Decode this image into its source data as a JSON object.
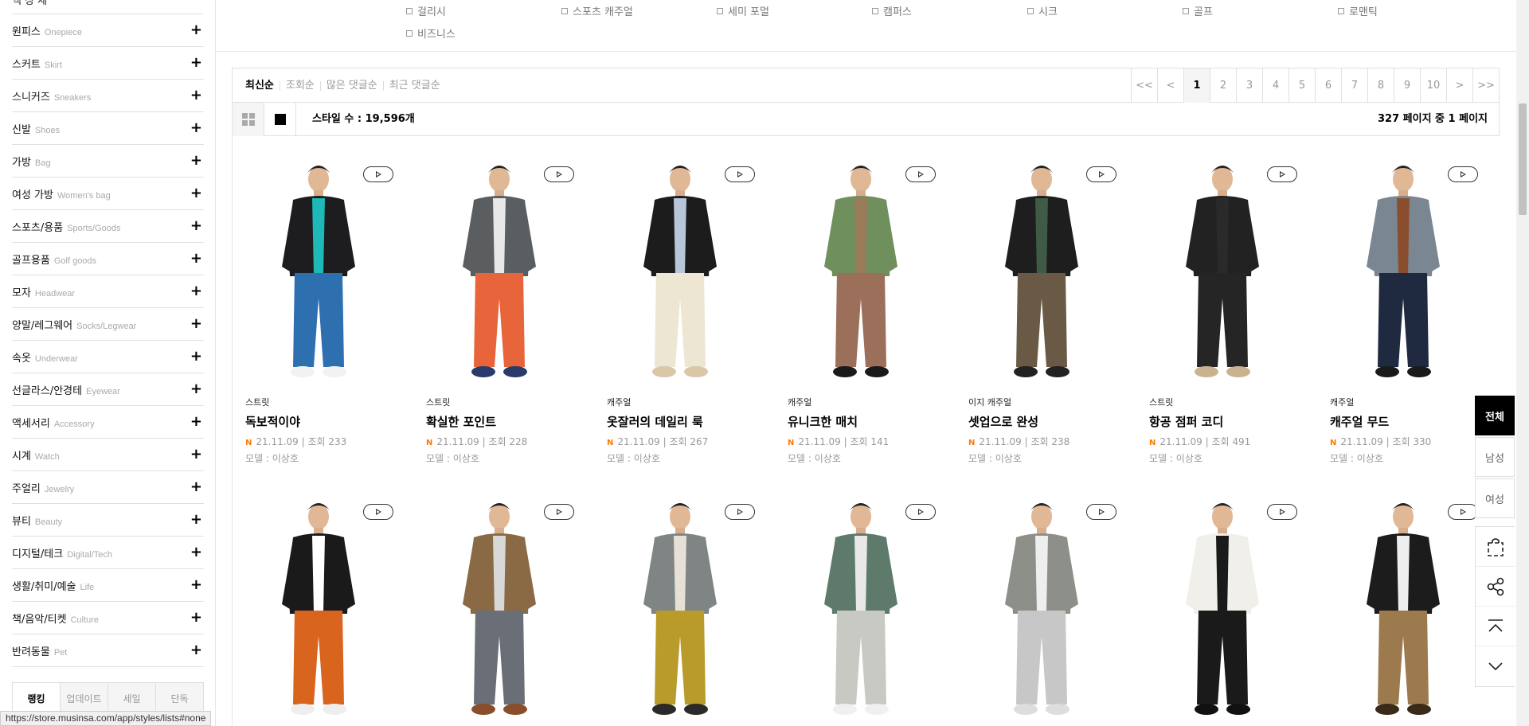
{
  "sidebar": {
    "top_cut": "액 상 세",
    "categories": [
      {
        "ko": "원피스",
        "en": "Onepiece"
      },
      {
        "ko": "스커트",
        "en": "Skirt"
      },
      {
        "ko": "스니커즈",
        "en": "Sneakers"
      },
      {
        "ko": "신발",
        "en": "Shoes"
      },
      {
        "ko": "가방",
        "en": "Bag"
      },
      {
        "ko": "여성 가방",
        "en": "Women's bag"
      },
      {
        "ko": "스포츠/용품",
        "en": "Sports/Goods"
      },
      {
        "ko": "골프용품",
        "en": "Golf goods"
      },
      {
        "ko": "모자",
        "en": "Headwear"
      },
      {
        "ko": "양말/레그웨어",
        "en": "Socks/Legwear"
      },
      {
        "ko": "속옷",
        "en": "Underwear"
      },
      {
        "ko": "선글라스/안경테",
        "en": "Eyewear"
      },
      {
        "ko": "액세서리",
        "en": "Accessory"
      },
      {
        "ko": "시계",
        "en": "Watch"
      },
      {
        "ko": "주얼리",
        "en": "Jewelry"
      },
      {
        "ko": "뷰티",
        "en": "Beauty"
      },
      {
        "ko": "디지털/테크",
        "en": "Digital/Tech"
      },
      {
        "ko": "생활/취미/예술",
        "en": "Life"
      },
      {
        "ko": "책/음악/티켓",
        "en": "Culture"
      },
      {
        "ko": "반려동물",
        "en": "Pet"
      }
    ],
    "plus": "+",
    "rank_tabs": [
      "랭킹",
      "업데이트",
      "세일",
      "단독"
    ]
  },
  "status_url": "https://store.musinsa.com/app/styles/lists#none",
  "style_filter": [
    "걸리시",
    "스포츠 캐주얼",
    "세미 포멀",
    "캠퍼스",
    "시크",
    "골프",
    "로맨틱",
    "비즈니스"
  ],
  "sort": [
    "최신순",
    "조회순",
    "많은 댓글순",
    "최근 댓글순"
  ],
  "pager": [
    "<<",
    "<",
    "1",
    "2",
    "3",
    "4",
    "5",
    "6",
    "7",
    "8",
    "9",
    "10",
    ">",
    ">>"
  ],
  "pager_active": "1",
  "style_count": "스타일 수 : 19,596개",
  "page_count": "327 페이지 중 1 페이지",
  "row1": [
    {
      "cat": "스트릿",
      "title": "독보적이야",
      "date": "21.11.09 | 조회 233",
      "model": "모델 : 이상호",
      "jacket": "#1d1d1f",
      "inner": "#1fb8b8",
      "pants": "#2e6fb0",
      "shoes": "#f2f2f2"
    },
    {
      "cat": "스트릿",
      "title": "확실한 포인트",
      "date": "21.11.09 | 조회 228",
      "model": "모델 : 이상호",
      "jacket": "#5b5e60",
      "inner": "#e8e8e8",
      "pants": "#e8643a",
      "shoes": "#2a3a6a"
    },
    {
      "cat": "캐주얼",
      "title": "옷잘러의 데일리 룩",
      "date": "21.11.09 | 조회 267",
      "model": "모델 : 이상호",
      "jacket": "#1c1c1c",
      "inner": "#b8c6d9",
      "pants": "#ede6d3",
      "shoes": "#d9c7a8"
    },
    {
      "cat": "캐주얼",
      "title": "유니크한 매치",
      "date": "21.11.09 | 조회 141",
      "model": "모델 : 이상호",
      "jacket": "#6f8f5c",
      "inner": "#9a7b5a",
      "pants": "#9b6f5a",
      "shoes": "#1a1a1a"
    },
    {
      "cat": "이지 캐주얼",
      "title": "셋업으로 완성",
      "date": "21.11.09 | 조회 238",
      "model": "모델 : 이상호",
      "jacket": "#1e1e1e",
      "inner": "#3f5a45",
      "pants": "#6a5a45",
      "shoes": "#222222"
    },
    {
      "cat": "스트릿",
      "title": "항공 점퍼 코디",
      "date": "21.11.09 | 조회 491",
      "model": "모델 : 이상호",
      "jacket": "#222222",
      "inner": "#2a2a2a",
      "pants": "#252525",
      "shoes": "#c9b28f"
    },
    {
      "cat": "캐주얼",
      "title": "캐주얼 무드",
      "date": "21.11.09 | 조회 330",
      "model": "모델 : 이상호",
      "jacket": "#7a8792",
      "inner": "#8a4e2e",
      "pants": "#1f2a40",
      "shoes": "#1a1a1a"
    }
  ],
  "row2": [
    {
      "jacket": "#1a1a1a",
      "inner": "#ffffff",
      "pants": "#d8641e",
      "shoes": "#eeeeee"
    },
    {
      "jacket": "#8a6a44",
      "inner": "#d8d8d8",
      "pants": "#6a6e76",
      "shoes": "#8a4f2a"
    },
    {
      "jacket": "#7f8584",
      "inner": "#e6e0d6",
      "pants": "#b89b2a",
      "shoes": "#2a2a2a"
    },
    {
      "jacket": "#5e7a6a",
      "inner": "#e8e8e8",
      "pants": "#c9c9c4",
      "shoes": "#f0f0f0"
    },
    {
      "jacket": "#8c9088",
      "inner": "#eeeeee",
      "pants": "#c7c7c7",
      "shoes": "#dddddd"
    },
    {
      "jacket": "#f0efe9",
      "inner": "#1a1a1a",
      "pants": "#1a1a1a",
      "shoes": "#111111"
    },
    {
      "jacket": "#1c1c1c",
      "inner": "#eeeeee",
      "pants": "#9c7a4e",
      "shoes": "#3a2a1a"
    }
  ],
  "float_nav": {
    "tabs": [
      "전체",
      "남성",
      "여성"
    ],
    "active": "전체"
  }
}
